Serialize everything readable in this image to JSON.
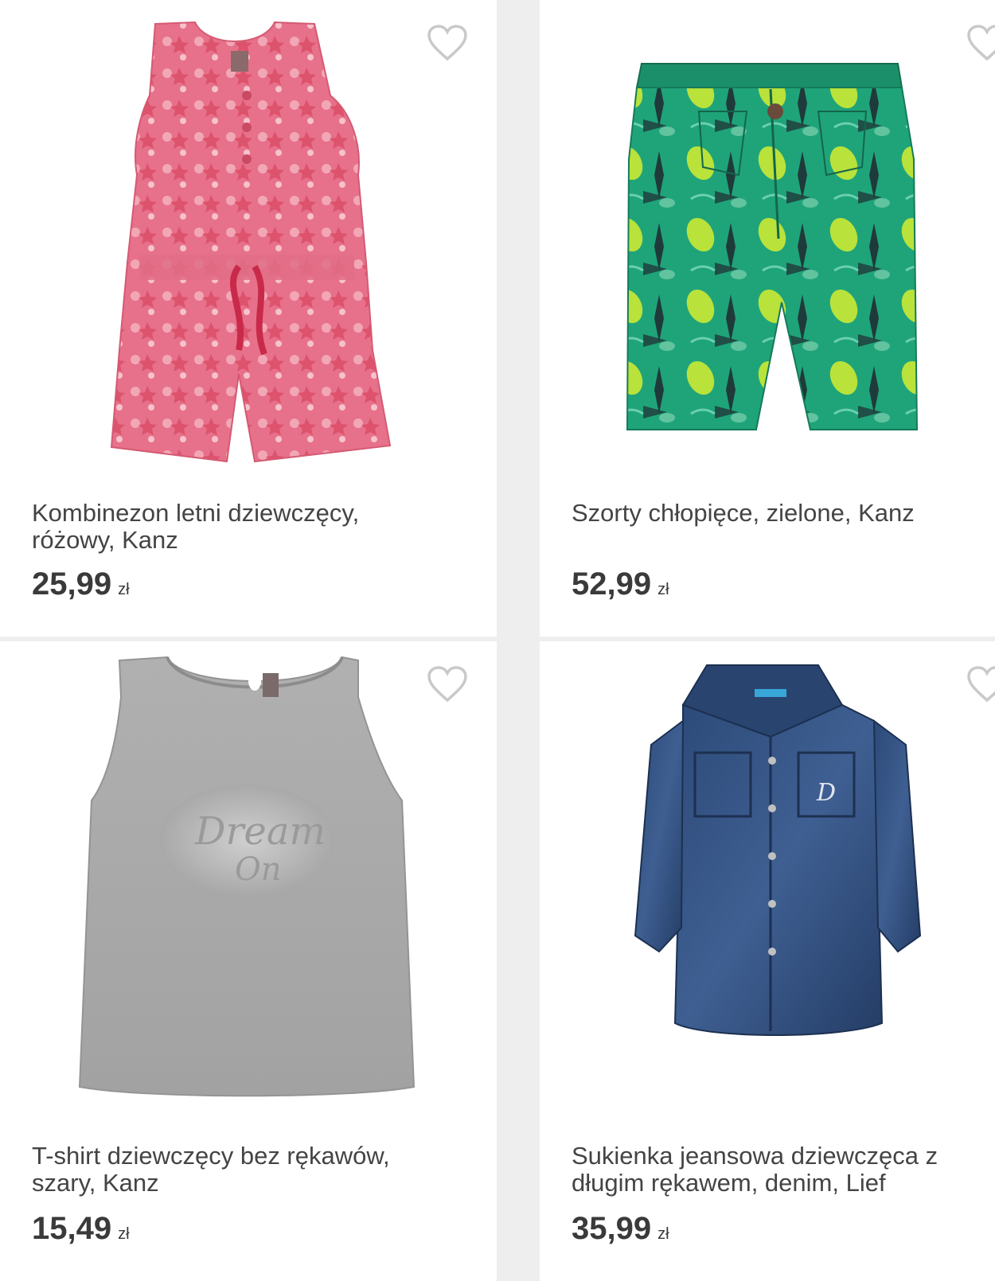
{
  "products": [
    {
      "name": "Kombinezon letni dziewczęcy, różowy, Kanz",
      "price": "25,99",
      "currency": "zł",
      "image_icon": "pink-romper-image",
      "wishlist_icon": "heart-outline-icon"
    },
    {
      "name": "Szorty chłopięce, zielone, Kanz",
      "price": "52,99",
      "currency": "zł",
      "image_icon": "green-shorts-image",
      "wishlist_icon": "heart-outline-icon"
    },
    {
      "name": "T-shirt dziewczęcy bez rękawów, szary, Kanz",
      "price": "15,49",
      "currency": "zł",
      "image_icon": "grey-tank-top-image",
      "wishlist_icon": "heart-outline-icon"
    },
    {
      "name": "Sukienka jeansowa dziewczęca z długim rękawem, denim, Lief",
      "price": "35,99",
      "currency": "zł",
      "image_icon": "denim-dress-image",
      "wishlist_icon": "heart-outline-icon"
    }
  ],
  "colors": {
    "background": "#eeeeee",
    "card": "#ffffff",
    "text": "#444444",
    "heart_outline": "#cccccc"
  }
}
